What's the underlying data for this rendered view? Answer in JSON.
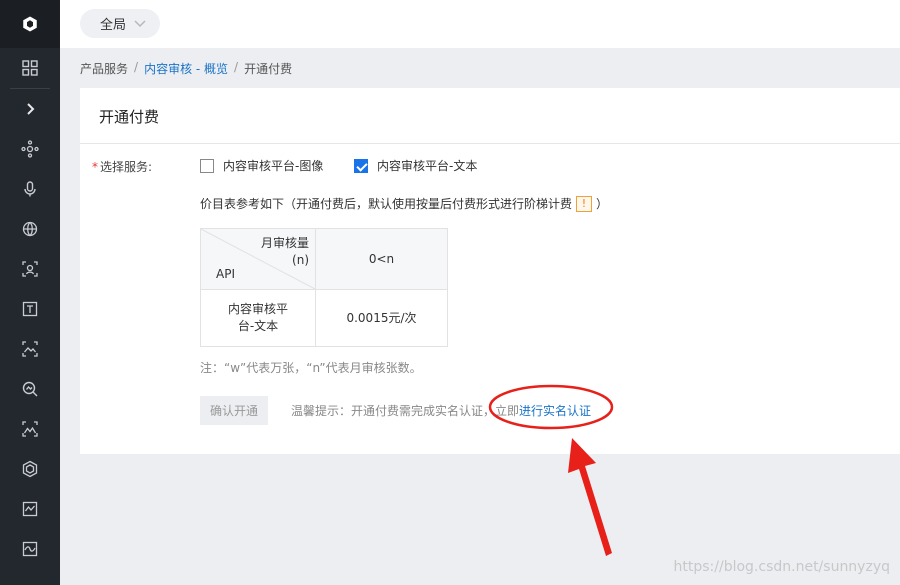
{
  "topbar": {
    "scope_label": "全局"
  },
  "breadcrumb": {
    "root": "产品服务",
    "parent": "内容审核 - 概览",
    "current": "开通付费"
  },
  "panel": {
    "title": "开通付费",
    "service_label": "选择服务:",
    "required_mark": "*",
    "options": [
      {
        "label": "内容审核平台-图像",
        "checked": false
      },
      {
        "label": "内容审核平台-文本",
        "checked": true
      }
    ],
    "price_note": "价目表参考如下（开通付费后，默认使用按量后付费形式进行阶梯计费",
    "price_note_icon": "!",
    "price_note_end": "）",
    "table": {
      "corner_top_line1": "月审核量",
      "corner_top_line2": "(n)",
      "corner_bottom": "API",
      "header": "0<n",
      "row_name_line1": "内容审核平",
      "row_name_line2": "台-文本",
      "row_price": "0.0015元/次"
    },
    "footnote": "注：“w”代表万张，“n”代表月审核张数。",
    "confirm_button": "确认开通",
    "tip_prefix": "温馨提示：开通付费需完成实名认证，立即",
    "tip_link": "进行实名认证"
  },
  "watermark": "https://blog.csdn.net/sunnyzyq",
  "colors": {
    "rail": "#23272e",
    "accent": "#1a73e8",
    "annotation": "#e8201a"
  },
  "rail_icons": [
    "logo-cube-icon",
    "grid-icon",
    "chevron-right-icon",
    "nodes-icon",
    "microphone-icon",
    "globe-icon",
    "face-scan-icon",
    "text-icon",
    "image-scan-icon",
    "magnifier-icon",
    "image-icon",
    "cube-icon",
    "chart-image-icon",
    "wave-icon"
  ]
}
